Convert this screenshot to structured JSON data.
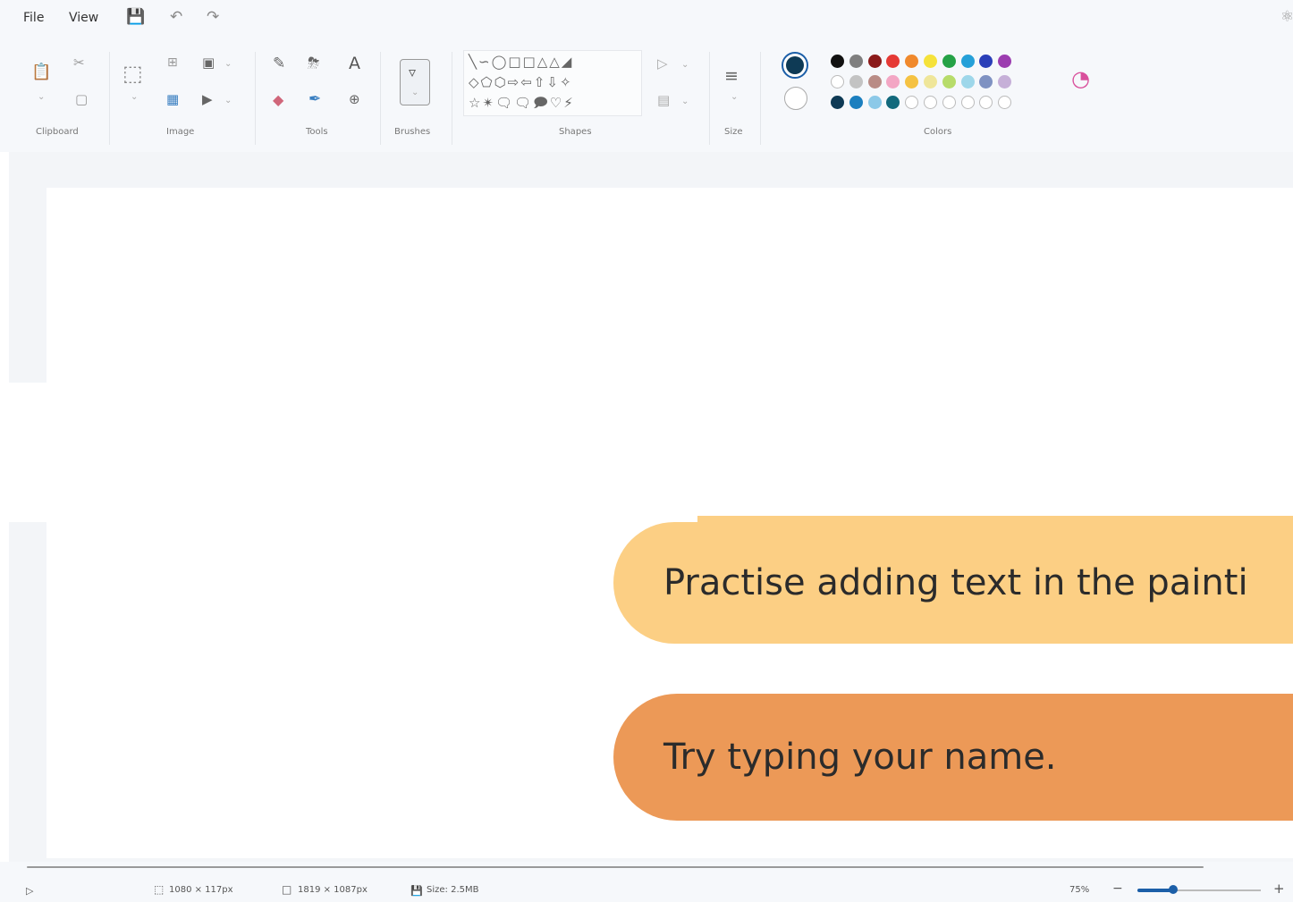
{
  "menubar": {
    "file": "File",
    "view": "View",
    "save_icon": "save-icon",
    "undo_icon": "undo-icon",
    "redo_icon": "redo-icon",
    "share_icon": "share-icon"
  },
  "ribbon": {
    "groups": {
      "clipboard": "Clipboard",
      "image": "Image",
      "tools": "Tools",
      "brushes": "Brushes",
      "shapes": "Shapes",
      "size": "Size",
      "colors": "Colors"
    },
    "tools": {
      "text_tool": "A"
    }
  },
  "colors": {
    "primary": "#0e3a55",
    "secondary": "#ffffff",
    "row1": [
      "#111111",
      "#7f7f7f",
      "#8b1a1a",
      "#e53935",
      "#f0892c",
      "#f5e23a",
      "#25a246",
      "#25a0d8",
      "#2a3fb8",
      "#9c3db0"
    ],
    "row2": [
      "#ffffff",
      "#c3c3c3",
      "#b98c86",
      "#f3a6c4",
      "#f5c242",
      "#efe69a",
      "#b7dc6a",
      "#9ed7ea",
      "#7f92c2",
      "#c6b0d8"
    ],
    "row3": [
      "#0e3a55",
      "#1b7fbf",
      "#8cc9e8",
      "#12697c",
      "#ffffff",
      "#ffffff",
      "#ffffff",
      "#ffffff",
      "#ffffff",
      "#ffffff"
    ]
  },
  "canvas": {
    "prompt1": "Practise adding text in the painti",
    "prompt2": "Try typing your name.",
    "prompt1_color": "#fccf84",
    "prompt2_color": "#ec9957"
  },
  "statusbar": {
    "selection": "1080 × 117px",
    "canvas_size": "1819 × 1087px",
    "file_size": "Size: 2.5MB",
    "zoom": "75%",
    "zoom_minus": "−",
    "zoom_plus": "+"
  }
}
